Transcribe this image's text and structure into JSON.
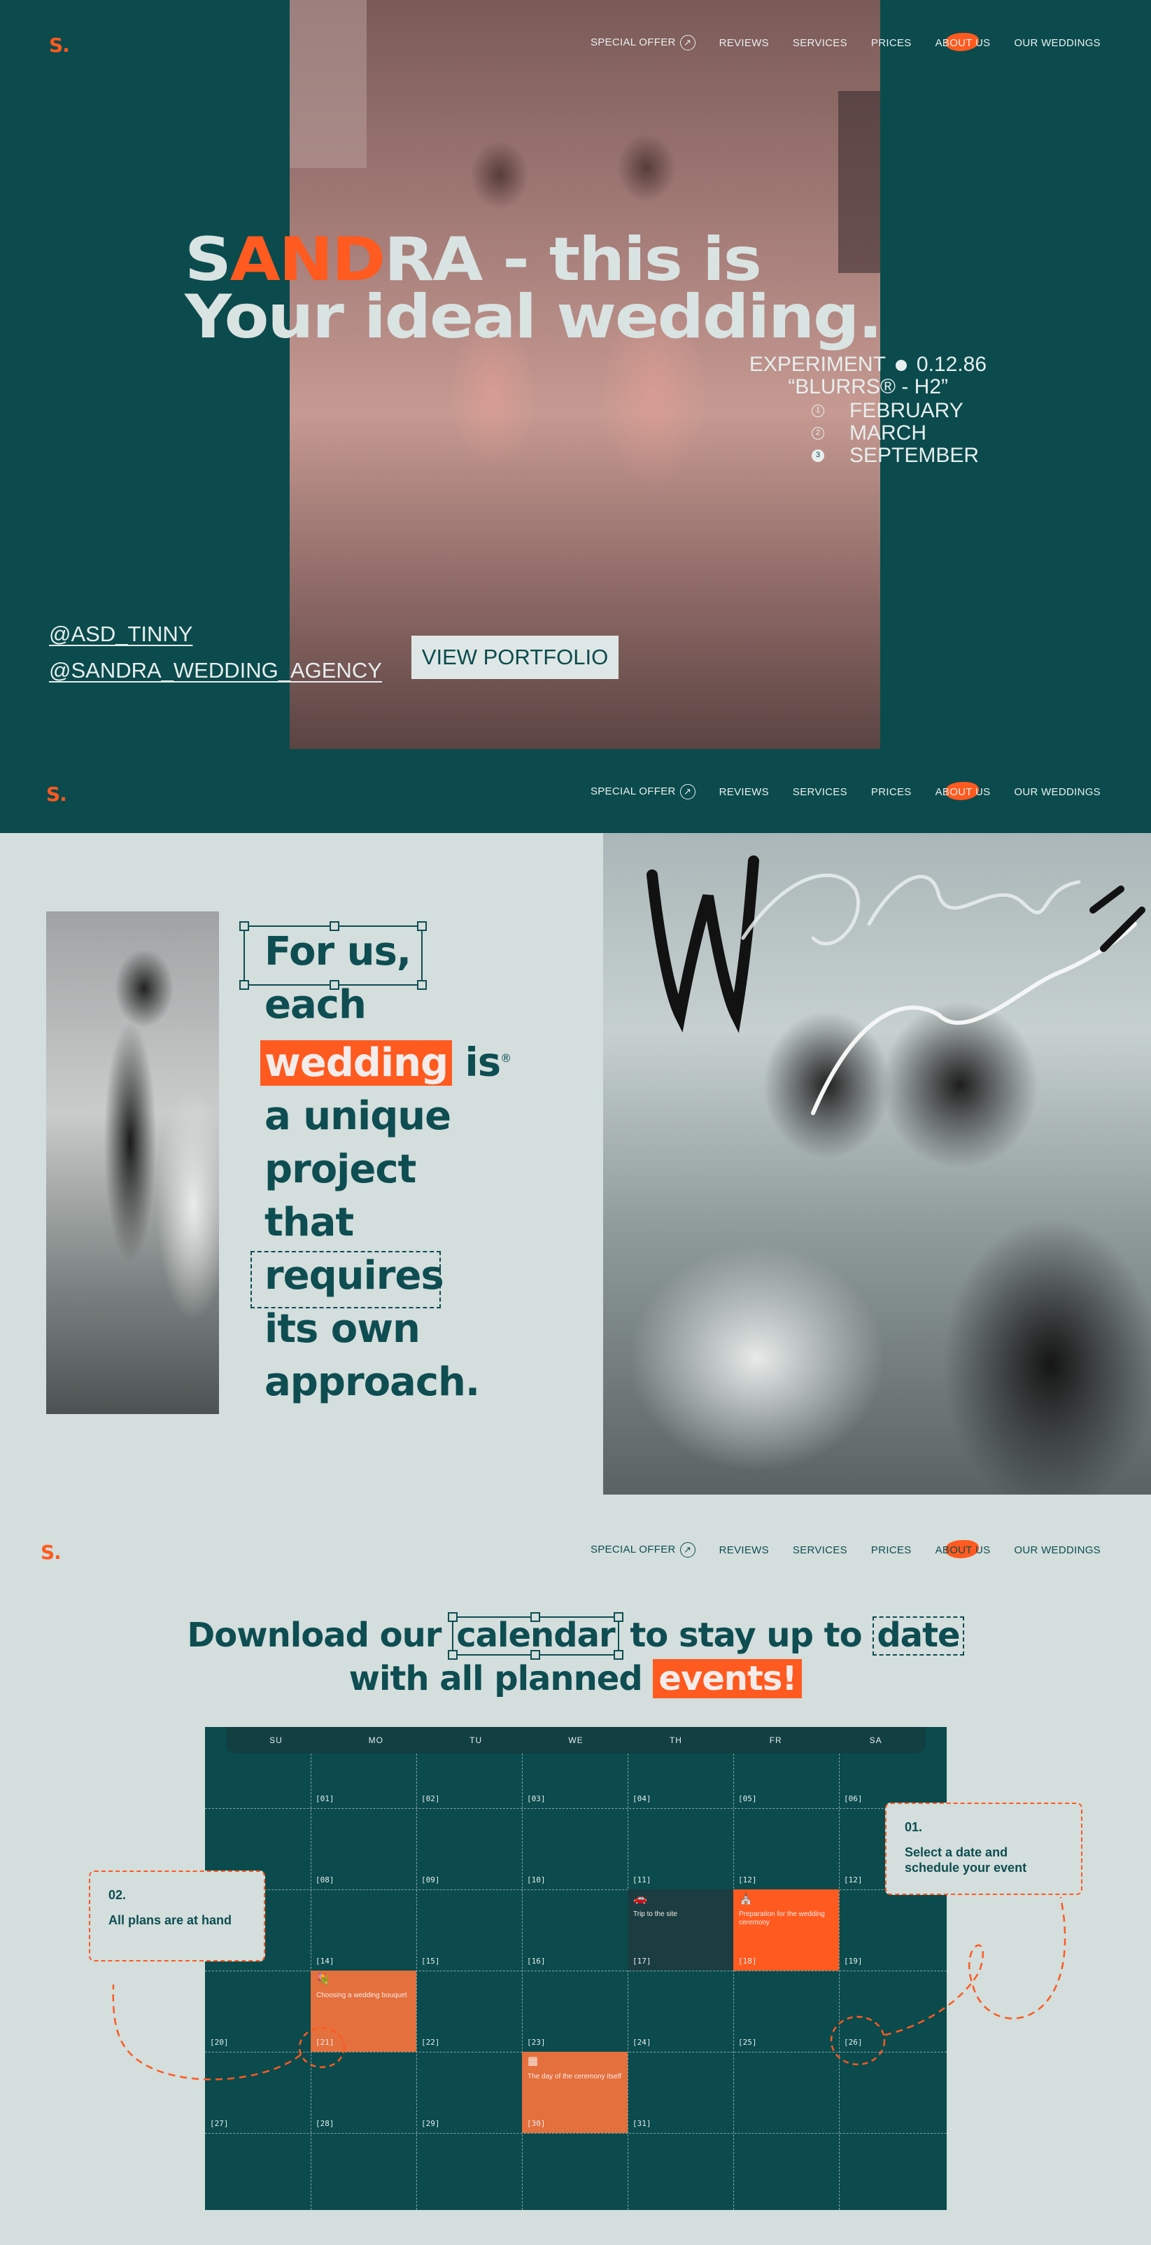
{
  "nav": {
    "logo": "S.",
    "special_offer": "SPECIAL OFFER",
    "reviews": "REVIEWS",
    "services": "SERVICES",
    "prices": "PRICES",
    "about_us": "ABOUT US",
    "our_weddings": "OUR WEDDINGS",
    "arrow_icon": "↗"
  },
  "hero": {
    "title_orange": "AND",
    "title_s": "S",
    "title_rest_line1": "RA - this is",
    "title_line2": "Your ideal wedding.",
    "experiment": "EXPERIMENT",
    "code": "0.12.86",
    "blurrs": "“BLURRS® - H2”",
    "months": [
      {
        "num": "1",
        "label": "FEBRUARY"
      },
      {
        "num": "2",
        "label": "MARCH"
      },
      {
        "num": "3",
        "label": "SEPTEMBER"
      }
    ],
    "handle1": "@ASD_TINNY",
    "handle2": "@SANDRA_WEDDING_AGENCY",
    "portfolio_button": "VIEW PORTFOLIO"
  },
  "about": {
    "line1": "For us,",
    "line2": "each",
    "line3_hl": "wedding",
    "line3_rest": "is",
    "reg": "®",
    "line4": "a unique",
    "line5": "project",
    "line6": "that",
    "line7": "requires",
    "line8": "its own",
    "line9": "approach."
  },
  "calendar_section": {
    "title_a": "Download our",
    "title_calendar": "calendar",
    "title_b": "to stay up to",
    "title_date": "date",
    "title_c": "with all planned",
    "title_events": "events!",
    "days": [
      "SU",
      "MO",
      "TU",
      "WE",
      "TH",
      "FR",
      "SA"
    ],
    "dates": {
      "d01": "[01]",
      "d02": "[02]",
      "d03": "[03]",
      "d04": "[04]",
      "d05": "[05]",
      "d06": "[06]",
      "d08": "[08]",
      "d09": "[09]",
      "d10": "[10]",
      "d11": "[11]",
      "d12": "[12]",
      "d12b": "[12]",
      "d14": "[14]",
      "d15": "[15]",
      "d16": "[16]",
      "d17": "[17]",
      "d18": "[18]",
      "d19": "[19]",
      "d20": "[20]",
      "d21": "[21]",
      "d22": "[22]",
      "d23": "[23]",
      "d24": "[24]",
      "d25": "[25]",
      "d26": "[26]",
      "d27": "[27]",
      "d28": "[28]",
      "d29": "[29]",
      "d30": "[30]",
      "d31": "[31]"
    },
    "events": {
      "trip": "Trip to the site",
      "prep": "Preparation for the wedding ceremony",
      "bouquet": "Choosing a wedding bouquet",
      "ceremony": "The day of the ceremony itself"
    },
    "note1_num": "01.",
    "note1_text": "Select a date and schedule your event",
    "note2_num": "02.",
    "note2_text": "All plans are at hand"
  },
  "colors": {
    "teal": "#0b4b4d",
    "orange": "#ff5a1f",
    "light": "#d3dedd"
  }
}
